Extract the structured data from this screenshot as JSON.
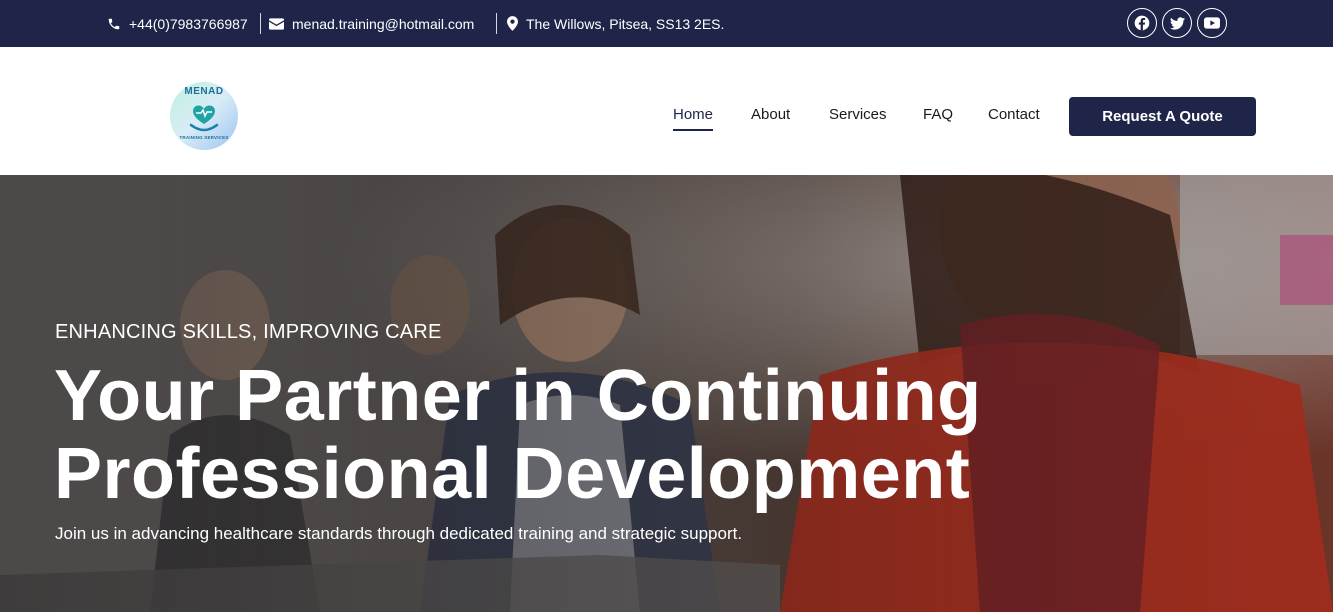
{
  "topbar": {
    "phone": "+44(0)7983766987",
    "email": "menad.training@hotmail.com",
    "address": "The Willows, Pitsea, SS13 2ES.",
    "social": [
      {
        "name": "facebook-icon"
      },
      {
        "name": "twitter-icon"
      },
      {
        "name": "youtube-icon"
      }
    ]
  },
  "header": {
    "logo": {
      "brand": "MENAD",
      "tagline": "TRAINING SERVICES"
    },
    "nav": {
      "home": "Home",
      "about": "About",
      "services": "Services",
      "faq": "FAQ",
      "contact": "Contact"
    },
    "cta": "Request A Quote"
  },
  "hero": {
    "eyebrow": "ENHANCING SKILLS, IMPROVING CARE",
    "title_line1": "Your Partner in Continuing",
    "title_line2": "Professional Development",
    "subtitle": "Join us in advancing healthcare standards through dedicated training and strategic support."
  },
  "colors": {
    "navy": "#1e2549",
    "teal": "#1fa3a3",
    "white": "#ffffff"
  }
}
